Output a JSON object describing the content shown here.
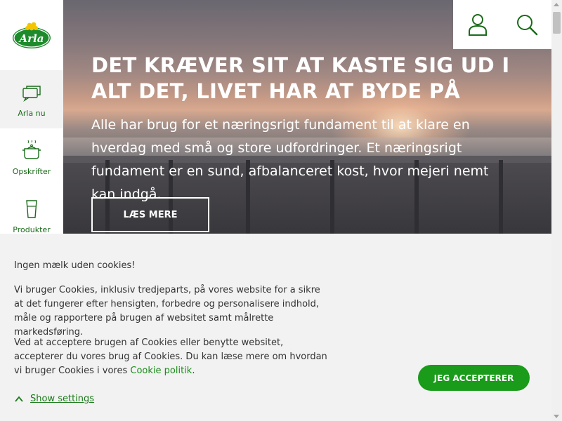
{
  "brand": {
    "logo_text": "Arla",
    "accent": "#1a9b1a",
    "active_bar": "#3cb43c"
  },
  "sidebar": {
    "items": [
      {
        "label": "Arla nu",
        "icon": "chat-bubbles-icon",
        "active": true
      },
      {
        "label": "Opskrifter",
        "icon": "cooking-pot-icon",
        "active": false
      },
      {
        "label": "Produkter",
        "icon": "glass-icon",
        "active": false
      }
    ]
  },
  "header": {
    "icons": [
      "user-icon",
      "search-icon"
    ]
  },
  "hero": {
    "title": "DET KRÆVER SIT AT KASTE SIG UD I ALT DET, LIVET HAR AT BYDE PÅ",
    "text": "Alle har brug for et næringsrigt fundament til at klare en hverdag med små og store udfordringer. Et næringsrigt fundament er en sund, afbalanceret kost, hvor mejeri nemt kan indgå.",
    "button_label": "LÆS MERE"
  },
  "cookie": {
    "title": "Ingen mælk uden cookies!",
    "paragraph1": "Vi bruger Cookies, inklusiv tredjeparts, på vores website for a sikre at det fungerer efter hensigten, forbedre og personalisere indhold, måle og rapportere på brugen af websitet samt målrette markedsføring.",
    "paragraph2_pre": "Ved at acceptere brugen af Cookies eller benytte websitet, accepterer du vores brug af Cookies. Du kan læse mere om hvordan vi bruger Cookies i vores ",
    "policy_link": "Cookie politik",
    "paragraph2_post": ".",
    "accept_label": "JEG ACCEPTERER",
    "settings_label": "Show settings"
  }
}
